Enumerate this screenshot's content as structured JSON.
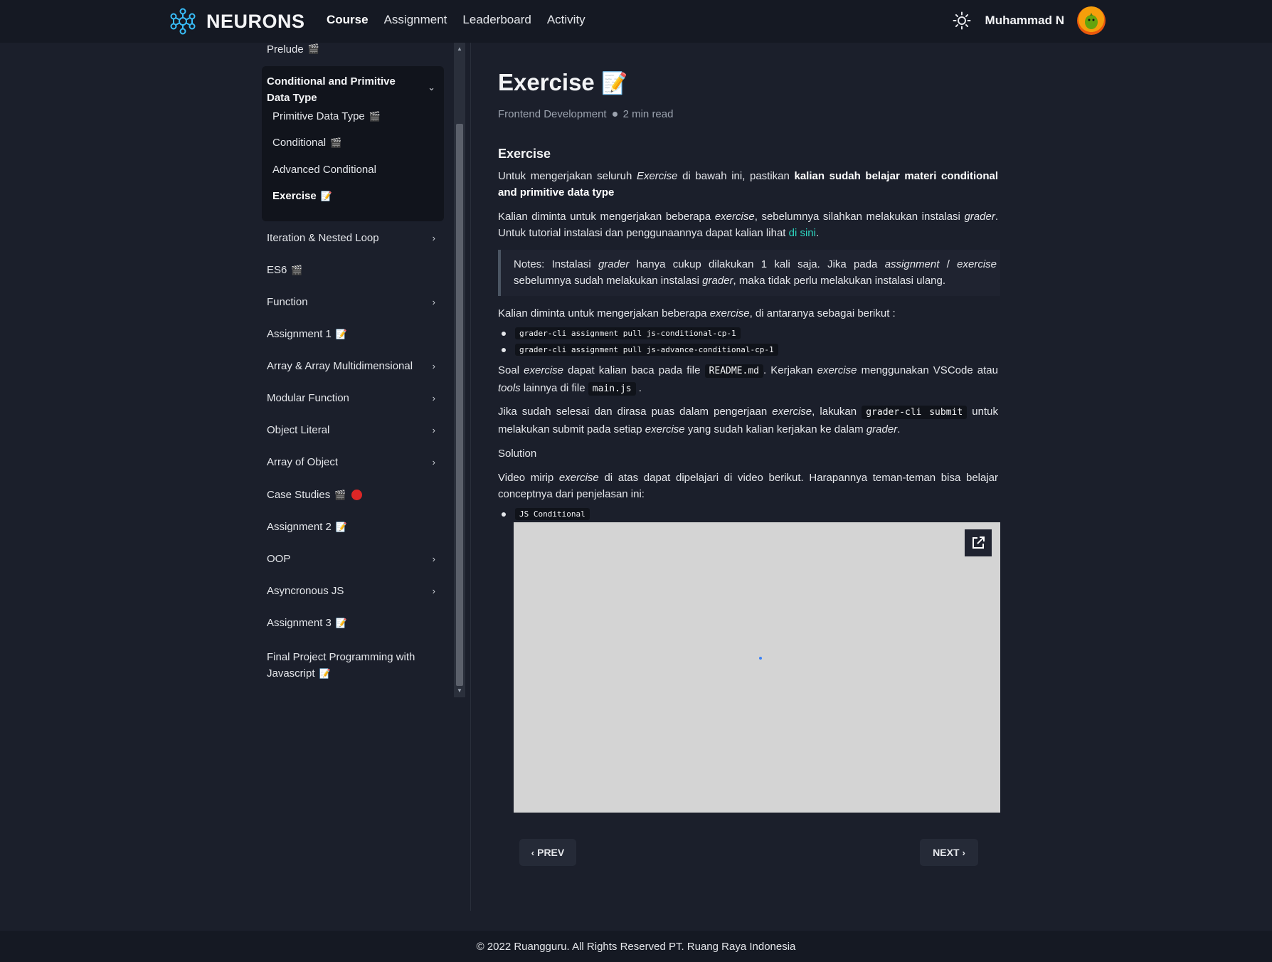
{
  "header": {
    "brand": "NEURONS",
    "nav": [
      "Course",
      "Assignment",
      "Leaderboard",
      "Activity"
    ],
    "active_nav": "Course",
    "user_name": "Muhammad N"
  },
  "sidebar": {
    "prelude": "Prelude",
    "group": {
      "title": "Conditional and Primitive Data Type",
      "items": [
        "Primitive Data Type",
        "Conditional",
        "Advanced Conditional",
        "Exercise"
      ]
    },
    "items": [
      "Iteration & Nested Loop",
      "ES6",
      "Function",
      "Assignment 1",
      "Array & Array Multidimensional",
      "Modular Function",
      "Object Literal",
      "Array of Object",
      "Case Studies",
      "Assignment 2",
      "OOP",
      "Asyncronous JS",
      "Assignment 3",
      "Final Project Programming with",
      "Javascript"
    ]
  },
  "main": {
    "title": "Exercise",
    "category": "Frontend Development",
    "read_time": "2 min read",
    "section_title": "Exercise",
    "p1": {
      "a": "Untuk mengerjakan seluruh",
      "b": "Exercise",
      "c": "di bawah ini, pastikan",
      "d": "kalian sudah belajar materi conditional and",
      "e": "primitive data type"
    },
    "p2": {
      "a": "Kalian diminta untuk mengerjakan beberapa",
      "b": "exercise",
      "c": ", sebelumnya silahkan melakukan instalasi",
      "d": "grader",
      "e": ".",
      "f": "Untuk tutorial instalasi dan penggunaannya dapat kalian lihat",
      "link": "di sini",
      "g": "."
    },
    "note": {
      "a": "Notes: Instalasi",
      "b": "grader",
      "c": "hanya cukup dilakukan 1 kali saja. Jika pada",
      "d": "assignment",
      "e": "/",
      "f": "exercise",
      "g": "sebelumnya",
      "h": "sudah melakukan instalasi",
      "i": "grader",
      "j": ", maka tidak perlu melakukan instalasi ulang."
    },
    "p3": {
      "a": "Kalian diminta untuk mengerjakan beberapa",
      "b": "exercise",
      "c": ", di antaranya sebagai berikut :"
    },
    "commands": [
      "grader-cli assignment pull js-conditional-cp-1",
      "grader-cli assignment pull js-advance-conditional-cp-1"
    ],
    "p4": {
      "a": "Soal",
      "b": "exercise",
      "c": "dapat kalian baca pada file",
      "d": "README.md",
      "e": ". Kerjakan",
      "f": "exercise",
      "g": "menggunakan VSCode atau",
      "h": "tools",
      "i": "lainnya di file",
      "j": "main.js",
      "k": "."
    },
    "p5": {
      "a": "Jika sudah selesai dan dirasa puas dalam pengerjaan",
      "b": "exercise",
      "c": ", lakukan",
      "d": "grader-cli submit",
      "e": "untuk",
      "f": "melakukan submit pada setiap",
      "g": "exercise",
      "h": "yang sudah kalian kerjakan ke dalam",
      "i": "grader",
      "j": "."
    },
    "solution": "Solution",
    "p6": {
      "a": "Video mirip",
      "b": "exercise",
      "c": "di atas dapat dipelajari di video berikut. Harapannya teman-teman bisa belajar",
      "d": "conceptnya dari penjelasan ini:"
    },
    "video_label": "JS Conditional",
    "prev": "PREV",
    "next": "NEXT"
  },
  "footer": "© 2022 Ruangguru. All Rights Reserved PT. Ruang Raya Indonesia"
}
